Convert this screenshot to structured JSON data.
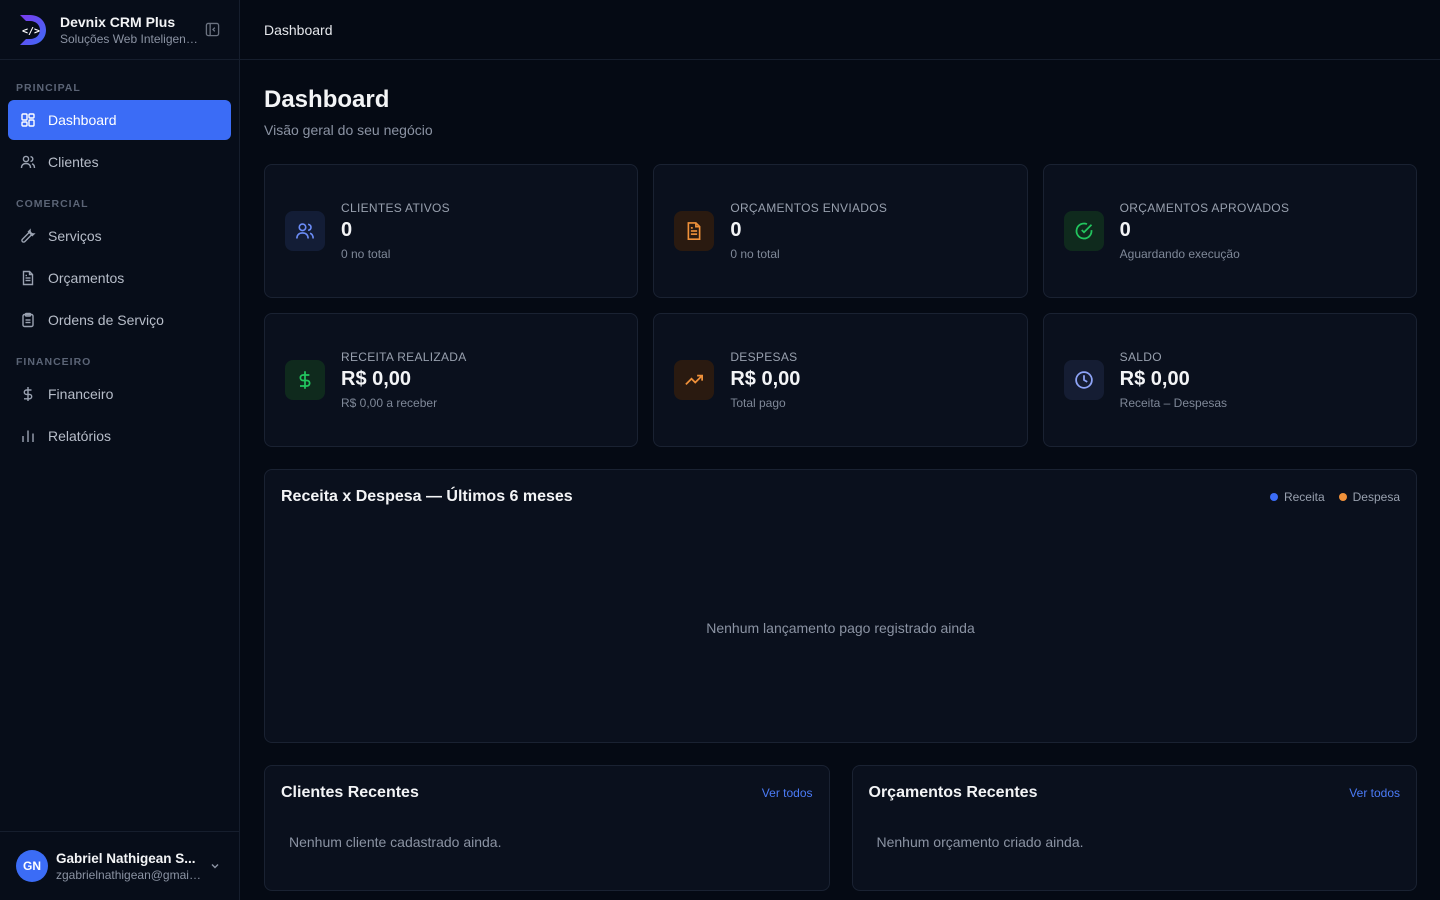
{
  "sidebar": {
    "brand": {
      "title": "Devnix CRM Plus",
      "subtitle": "Soluções Web Inteligentes"
    },
    "sections": [
      {
        "label": "PRINCIPAL",
        "items": [
          {
            "label": "Dashboard",
            "icon": "grid-icon",
            "active": true
          },
          {
            "label": "Clientes",
            "icon": "users-icon"
          }
        ]
      },
      {
        "label": "COMERCIAL",
        "items": [
          {
            "label": "Serviços",
            "icon": "wrench-icon"
          },
          {
            "label": "Orçamentos",
            "icon": "document-icon"
          },
          {
            "label": "Ordens de Serviço",
            "icon": "clipboard-icon"
          }
        ]
      },
      {
        "label": "FINANCEIRO",
        "items": [
          {
            "label": "Financeiro",
            "icon": "dollar-icon"
          },
          {
            "label": "Relatórios",
            "icon": "bar-chart-icon"
          }
        ]
      }
    ],
    "user": {
      "initials": "GN",
      "name": "Gabriel Nathigean S...",
      "email": "zgabrielnathigean@gmail.com"
    }
  },
  "topbar": {
    "title": "Dashboard"
  },
  "page": {
    "title": "Dashboard",
    "subtitle": "Visão geral do seu negócio"
  },
  "stats": [
    {
      "label": "CLIENTES ATIVOS",
      "value": "0",
      "note": "0 no total",
      "icon": "users-icon",
      "color": "#6b8cf7",
      "bg": "#131d36"
    },
    {
      "label": "ORÇAMENTOS ENVIADOS",
      "value": "0",
      "note": "0 no total",
      "icon": "document-icon",
      "color": "#f0913a",
      "bg": "#2a1a10"
    },
    {
      "label": "ORÇAMENTOS APROVADOS",
      "value": "0",
      "note": "Aguardando execução",
      "icon": "check-circle-icon",
      "color": "#22c55e",
      "bg": "#0f2a1d"
    },
    {
      "label": "RECEITA REALIZADA",
      "value": "R$ 0,00",
      "note": "R$ 0,00 a receber",
      "icon": "dollar-icon",
      "color": "#22c55e",
      "bg": "#0f2a1d"
    },
    {
      "label": "DESPESAS",
      "value": "R$ 0,00",
      "note": "Total pago",
      "icon": "trending-up-icon",
      "color": "#f0913a",
      "bg": "#2a1a10"
    },
    {
      "label": "SALDO",
      "value": "R$ 0,00",
      "note": "Receita – Despesas",
      "icon": "clock-icon",
      "color": "#8ea4f7",
      "bg": "#151d33"
    }
  ],
  "chart": {
    "title": "Receita x Despesa — Últimos 6 meses",
    "empty": "Nenhum lançamento pago registrado ainda",
    "legend": [
      {
        "label": "Receita",
        "color": "#3b6cf6"
      },
      {
        "label": "Despesa",
        "color": "#f0913a"
      }
    ]
  },
  "recent_clients": {
    "title": "Clientes Recentes",
    "link": "Ver todos",
    "empty": "Nenhum cliente cadastrado ainda."
  },
  "recent_quotes": {
    "title": "Orçamentos Recentes",
    "link": "Ver todos",
    "empty": "Nenhum orçamento criado ainda."
  }
}
